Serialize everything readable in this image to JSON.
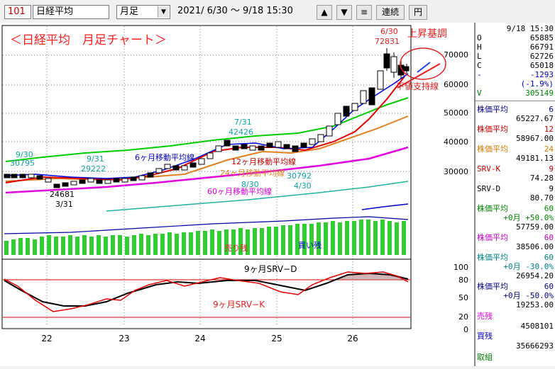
{
  "toolbar": {
    "code": "101",
    "name": "日経平均",
    "period": "月足",
    "date_range": "2021/ 6/30 ～  9/18 15:30",
    "up_icon": "▲",
    "down_icon": "▼",
    "menu_icon": "≡",
    "renzoku_label": "連続",
    "yen_label": "円"
  },
  "chart": {
    "title": "＜日経平均　月足チャート＞",
    "annot": {
      "up_label": "上昇基調",
      "support_label": "下値支持線",
      "ma6_label": "6ヶ月移動平均線",
      "ma12_label": "12ヶ月移動平均線",
      "ma24_label": "24ヶ月移動平均線",
      "ma60_label": "60ヶ月移動平均線",
      "sell_label": "売り残",
      "buy_label": "買い残",
      "srvd_label": "9ヶ月SRV−D",
      "srvk_label": "9ヶ月SRV−K",
      "p1_date": "9/30",
      "p1_val": "30795",
      "p2_date": "9/31",
      "p2_val": "29222",
      "p3_val": "24681",
      "p3_date": "3/31",
      "p4_date": "7/31",
      "p4_val": "42426",
      "p5_date": "8/30",
      "p6_val": "30792",
      "p6_date": "4/30",
      "p7_date": "6/30",
      "p7_val": "72831"
    },
    "price_axis": [
      "70000",
      "60000",
      "50000",
      "40000",
      "30000"
    ],
    "osc_axis": [
      "100",
      "80",
      "50",
      "20",
      "0"
    ],
    "x_axis": [
      "22",
      "23",
      "24",
      "25",
      "26"
    ]
  },
  "panel": {
    "datetime": "9/18 15:30",
    "ohlc": [
      {
        "k": "O",
        "v": "65885"
      },
      {
        "k": "H",
        "v": "66791"
      },
      {
        "k": "L",
        "v": "62726"
      },
      {
        "k": "C",
        "v": "65018"
      }
    ],
    "change": "-1293",
    "change_pct": "(-1.9%)",
    "volume_key": "V",
    "volume": "305149",
    "indicators": [
      {
        "label": "株価平均",
        "param": "6",
        "value": "65227.67",
        "color": "#000080"
      },
      {
        "label": "株価平均",
        "param": "12",
        "value": "58967.00",
        "color": "#c00000"
      },
      {
        "label": "株価平均",
        "param": "24",
        "value": "49181.13",
        "color": "#d07a00"
      },
      {
        "label": "SRV-K",
        "param": "9",
        "value": "74.28",
        "color": "#c00000"
      },
      {
        "label": "SRV-D",
        "param": "9",
        "value": "80.70",
        "color": "#000000"
      },
      {
        "label": "株価平均",
        "param": "60",
        "sub": "+0月 +50.0%",
        "value": "57759.00",
        "color": "#008000"
      },
      {
        "label": "株価平均",
        "param": "60",
        "value": "38506.00",
        "color": "#c000c0"
      },
      {
        "label": "株価平均",
        "param": "60",
        "sub": "+0月 -30.0%",
        "value": "26954.20",
        "color": "#008080"
      },
      {
        "label": "株価平均",
        "param": "60",
        "sub": "+0月 -50.0%",
        "value": "19253.00",
        "color": "#000080"
      }
    ],
    "sell_label": "売残",
    "sell_value": "4508101",
    "buy_label": "買残",
    "buy_value": "35666293",
    "torikumi_label": "取組"
  }
}
